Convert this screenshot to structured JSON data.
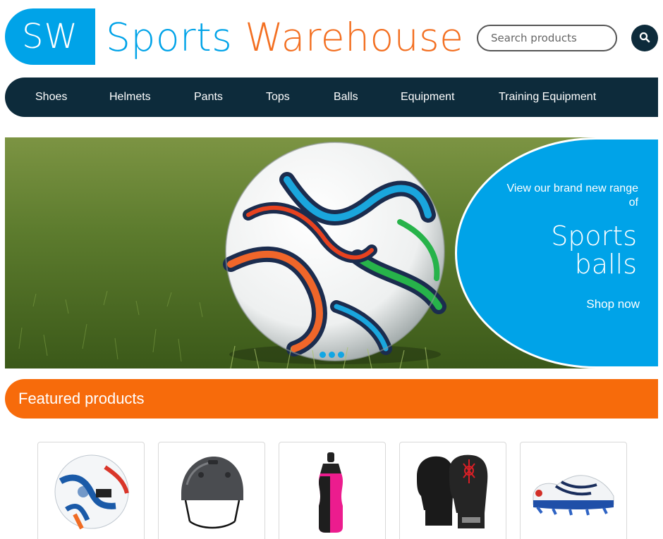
{
  "header": {
    "logo_badge": "SW",
    "logo_word1": "Sports",
    "logo_word2": "Warehouse",
    "search_placeholder": "Search products"
  },
  "nav": {
    "items": [
      "Shoes",
      "Helmets",
      "Pants",
      "Tops",
      "Balls",
      "Equipment",
      "Training Equipment"
    ]
  },
  "hero": {
    "intro": "View our brand new range of",
    "title": "Sports balls",
    "cta": "Shop now",
    "slide_count": 3
  },
  "featured": {
    "title": "Featured products",
    "products": [
      {
        "icon": "soccer-ball-icon"
      },
      {
        "icon": "helmet-icon"
      },
      {
        "icon": "water-bottle-icon"
      },
      {
        "icon": "boxing-gloves-icon"
      },
      {
        "icon": "running-shoe-icon"
      }
    ]
  },
  "colors": {
    "brand_blue": "#00a3e8",
    "brand_orange": "#f36f21",
    "featured_orange": "#f76b0b",
    "nav_dark": "#0d2b3b"
  }
}
